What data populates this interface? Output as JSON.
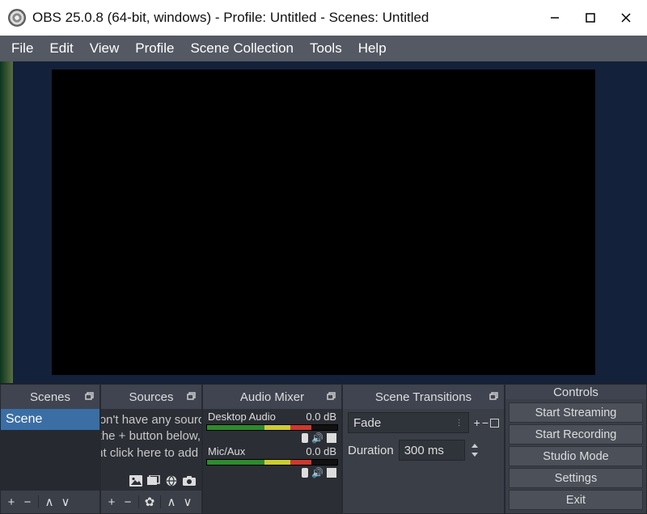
{
  "titlebar": {
    "title": "OBS 25.0.8 (64-bit, windows) - Profile: Untitled - Scenes: Untitled"
  },
  "menubar": [
    "File",
    "Edit",
    "View",
    "Profile",
    "Scene Collection",
    "Tools",
    "Help"
  ],
  "panels": {
    "scenes": {
      "title": "Scenes",
      "items": [
        "Scene"
      ]
    },
    "sources": {
      "title": "Sources",
      "hint": "You don't have any sources.\nClick the + button below,\nor right click here to add one."
    },
    "mixer": {
      "title": "Audio Mixer",
      "channels": [
        {
          "name": "Desktop Audio",
          "level": "0.0 dB"
        },
        {
          "name": "Mic/Aux",
          "level": "0.0 dB"
        }
      ]
    },
    "transitions": {
      "title": "Scene Transitions",
      "selected": "Fade",
      "duration_label": "Duration",
      "duration_value": "300 ms"
    },
    "controls": {
      "title": "Controls",
      "buttons": [
        "Start Streaming",
        "Start Recording",
        "Studio Mode",
        "Settings",
        "Exit"
      ]
    }
  }
}
